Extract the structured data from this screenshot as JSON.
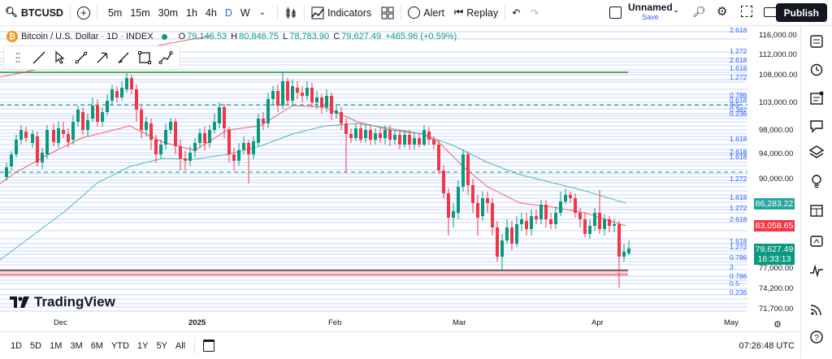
{
  "header": {
    "symbol": "BTCUSD",
    "intervals": [
      "5m",
      "15m",
      "30m",
      "1h",
      "4h",
      "D",
      "W"
    ],
    "active_interval": "D",
    "indicators_label": "Indicators",
    "alert_label": "Alert",
    "replay_label": "Replay",
    "layout_name": "Unnamed",
    "layout_status": "Save",
    "publish_label": "Publish"
  },
  "legend": {
    "title": "Bitcoin / U.S. Dollar · 1D · INDEX",
    "open": "79,146.53",
    "high": "80,846.75",
    "low": "78,783.90",
    "close": "79,627.49",
    "change": "+465.96 (+0.59%)"
  },
  "price_axis": {
    "labels": [
      "116,000.00",
      "112,000.00",
      "108,000.00",
      "103,000.00",
      "98,000.00",
      "94,000.00",
      "90,000.00",
      "77,000.00",
      "74,200.00",
      "71,700.00"
    ],
    "tags": [
      {
        "value": "86,283.22",
        "color": "#26a69a"
      },
      {
        "value": "83,058.65",
        "color": "#f23645"
      },
      {
        "value": "79,627.49",
        "color": "#089981"
      },
      {
        "value": "16:33:13",
        "color": "#089981"
      }
    ]
  },
  "fib_labels": [
    "2.618",
    "1.272",
    "2.618",
    "1.618",
    "1.272",
    "0.786",
    "0.618",
    "0.5",
    "0.382",
    "0.236",
    "1.618",
    "2.618",
    "1.618",
    "1.272",
    "1.618",
    "1.272",
    "2.618",
    "1.618",
    "1.272",
    "0.786",
    "3",
    "0.786",
    "0.5",
    "0.236"
  ],
  "date_axis": [
    "Dec",
    "2025",
    "Feb",
    "Mar",
    "Apr",
    "May"
  ],
  "ranges": [
    "1D",
    "5D",
    "1M",
    "3M",
    "6M",
    "YTD",
    "1Y",
    "5Y",
    "All"
  ],
  "clock": "07:26:48 UTC",
  "watermark": "TradingView",
  "colors": {
    "up": "#089981",
    "down": "#f23645",
    "accent": "#2962ff"
  }
}
